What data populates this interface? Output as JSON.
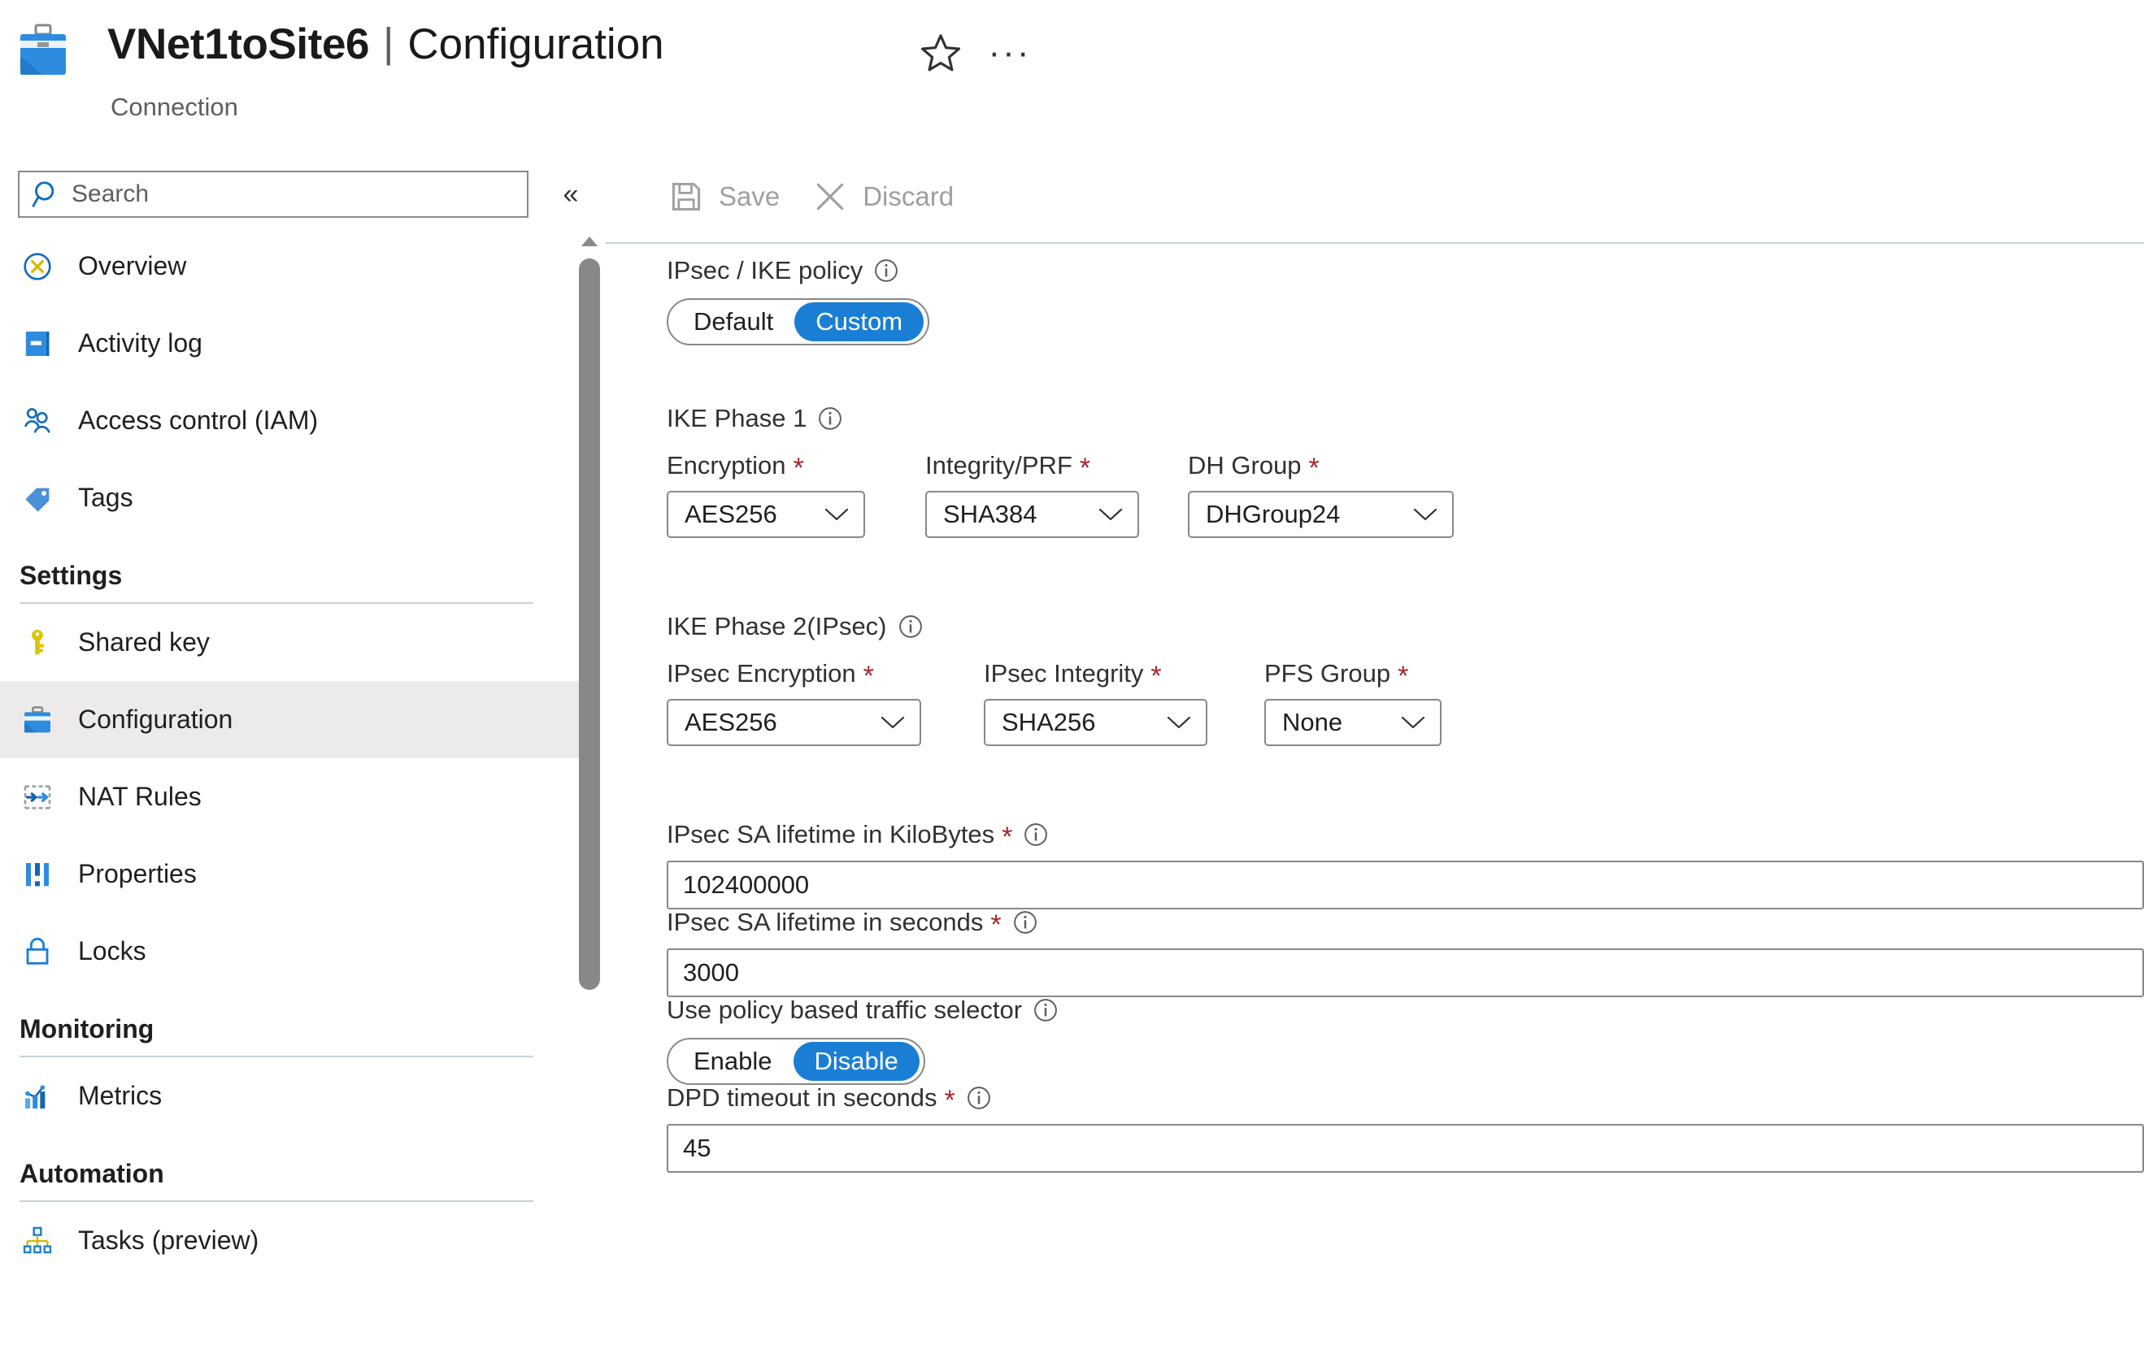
{
  "header": {
    "resource_icon": "vpn-connection-icon",
    "title": "VNet1toSite6",
    "separator": "|",
    "page": "Configuration",
    "subtitle": "Connection",
    "favorite_icon": "star-icon",
    "more_icon": "ellipsis-icon"
  },
  "sidebar": {
    "search": {
      "placeholder": "Search",
      "value": "",
      "icon": "search-icon"
    },
    "collapse_icon": "chevron-double-left-icon",
    "items": [
      {
        "label": "Overview",
        "icon": "overview-icon",
        "selected": false
      },
      {
        "label": "Activity log",
        "icon": "activity-log-icon",
        "selected": false
      },
      {
        "label": "Access control (IAM)",
        "icon": "access-control-icon",
        "selected": false
      },
      {
        "label": "Tags",
        "icon": "tags-icon",
        "selected": false
      }
    ],
    "groups": [
      {
        "title": "Settings",
        "items": [
          {
            "label": "Shared key",
            "icon": "key-icon",
            "selected": false
          },
          {
            "label": "Configuration",
            "icon": "toolbox-icon",
            "selected": true
          },
          {
            "label": "NAT Rules",
            "icon": "nat-rules-icon",
            "selected": false
          },
          {
            "label": "Properties",
            "icon": "properties-icon",
            "selected": false
          },
          {
            "label": "Locks",
            "icon": "lock-icon",
            "selected": false
          }
        ]
      },
      {
        "title": "Monitoring",
        "items": [
          {
            "label": "Metrics",
            "icon": "metrics-icon",
            "selected": false
          }
        ]
      },
      {
        "title": "Automation",
        "items": [
          {
            "label": "Tasks (preview)",
            "icon": "tasks-icon",
            "selected": false
          }
        ]
      }
    ]
  },
  "toolbar": {
    "save_label": "Save",
    "save_icon": "save-icon",
    "save_disabled": true,
    "discard_label": "Discard",
    "discard_icon": "close-icon",
    "discard_disabled": true
  },
  "form": {
    "policy": {
      "label": "IPsec / IKE policy",
      "info_icon": "info-icon",
      "options": [
        "Default",
        "Custom"
      ],
      "selected": "Custom"
    },
    "phase1": {
      "heading": "IKE Phase 1",
      "info_icon": "info-icon",
      "fields": [
        {
          "label": "Encryption",
          "required": true,
          "value": "AES256"
        },
        {
          "label": "Integrity/PRF",
          "required": true,
          "value": "SHA384"
        },
        {
          "label": "DH Group",
          "required": true,
          "value": "DHGroup24"
        }
      ]
    },
    "phase2": {
      "heading": "IKE Phase 2(IPsec)",
      "info_icon": "info-icon",
      "fields": [
        {
          "label": "IPsec Encryption",
          "required": true,
          "value": "AES256"
        },
        {
          "label": "IPsec Integrity",
          "required": true,
          "value": "SHA256"
        },
        {
          "label": "PFS Group",
          "required": true,
          "value": "None"
        }
      ]
    },
    "sa_kilobytes": {
      "label": "IPsec SA lifetime in KiloBytes",
      "required": true,
      "info_icon": "info-icon",
      "value": "102400000"
    },
    "sa_seconds": {
      "label": "IPsec SA lifetime in seconds",
      "required": true,
      "info_icon": "info-icon",
      "value": "3000"
    },
    "traffic_selector": {
      "label": "Use policy based traffic selector",
      "info_icon": "info-icon",
      "options": [
        "Enable",
        "Disable"
      ],
      "selected": "Disable"
    },
    "dpd_timeout": {
      "label": "DPD timeout in seconds",
      "required": true,
      "info_icon": "info-icon",
      "value": "45"
    }
  },
  "colors": {
    "accent": "#1a7fd4",
    "required_star": "#a4262c",
    "disabled_text": "#a19f9d",
    "selected_nav_bg": "#edebe9",
    "border": "#8a8886",
    "rule": "#c8d1d8"
  }
}
